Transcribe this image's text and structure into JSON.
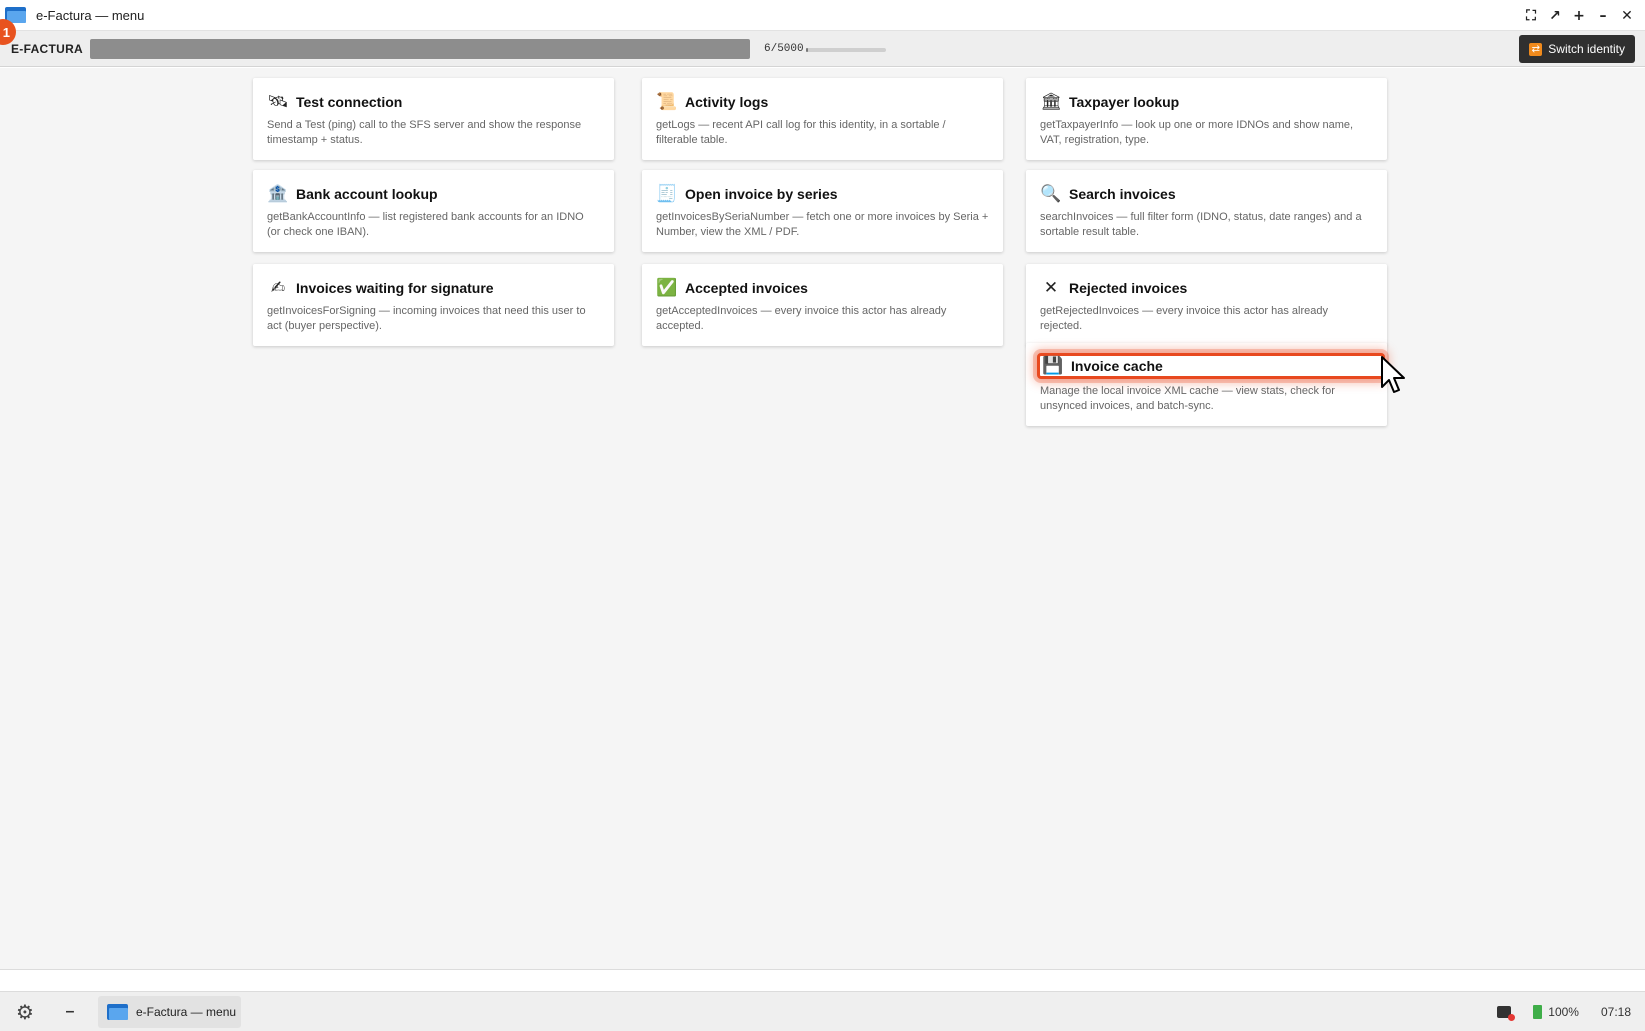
{
  "window": {
    "title": "e-Factura — menu",
    "controls": [
      "fullscreen-icon",
      "restore-icon",
      "maximize-icon",
      "minimize-icon",
      "close-icon"
    ]
  },
  "notification_badge": "1",
  "toolbar": {
    "brand": "E-FACTURA",
    "usage_text": "6/5000",
    "usage_fraction": 0.0012,
    "switch_identity_label": "Switch identity"
  },
  "cards": [
    {
      "icon": "satellite-icon",
      "glyph": "🛰",
      "title": "Test connection",
      "desc": "Send a Test (ping) call to the SFS server and show the response timestamp + status."
    },
    {
      "icon": "scroll-icon",
      "glyph": "📜",
      "title": "Activity logs",
      "desc": "getLogs — recent API call log for this identity, in a sortable / filterable table."
    },
    {
      "icon": "bank-icon",
      "glyph": "🏛",
      "title": "Taxpayer lookup",
      "desc": "getTaxpayerInfo — look up one or more IDNOs and show name, VAT, registration, type."
    },
    {
      "icon": "bank-building-icon",
      "glyph": "🏦",
      "title": "Bank account lookup",
      "desc": "getBankAccountInfo — list registered bank accounts for an IDNO (or check one IBAN)."
    },
    {
      "icon": "receipt-icon",
      "glyph": "🧾",
      "title": "Open invoice by series",
      "desc": "getInvoicesBySeriaNumber — fetch one or more invoices by Seria + Number, view the XML / PDF."
    },
    {
      "icon": "magnifier-icon",
      "glyph": "🔍",
      "title": "Search invoices",
      "desc": "searchInvoices — full filter form (IDNO, status, date ranges) and a sortable result table."
    },
    {
      "icon": "writing-hand-icon",
      "glyph": "✍",
      "title": "Invoices waiting for signature",
      "desc": "getInvoicesForSigning — incoming invoices that need this user to act (buyer perspective)."
    },
    {
      "icon": "check-mark-icon",
      "glyph": "✅",
      "title": "Accepted invoices",
      "desc": "getAcceptedInvoices — every invoice this actor has already accepted."
    },
    {
      "icon": "cross-mark-icon",
      "glyph": "✕",
      "title": "Rejected invoices",
      "desc": "getRejectedInvoices — every invoice this actor has already rejected."
    },
    {
      "icon": "floppy-disk-icon",
      "glyph": "💾",
      "title": "Invoice cache",
      "desc": "Manage the local invoice XML cache — view stats, check for unsynced invoices, and batch-sync."
    }
  ],
  "taskbar": {
    "task_label": "e-Factura — menu",
    "battery": "100%",
    "clock": "07:18"
  },
  "colors": {
    "highlight": "#e8491f",
    "toolbar_bg": "#eeeeee",
    "switch_btn_bg": "#2f2f2f"
  }
}
